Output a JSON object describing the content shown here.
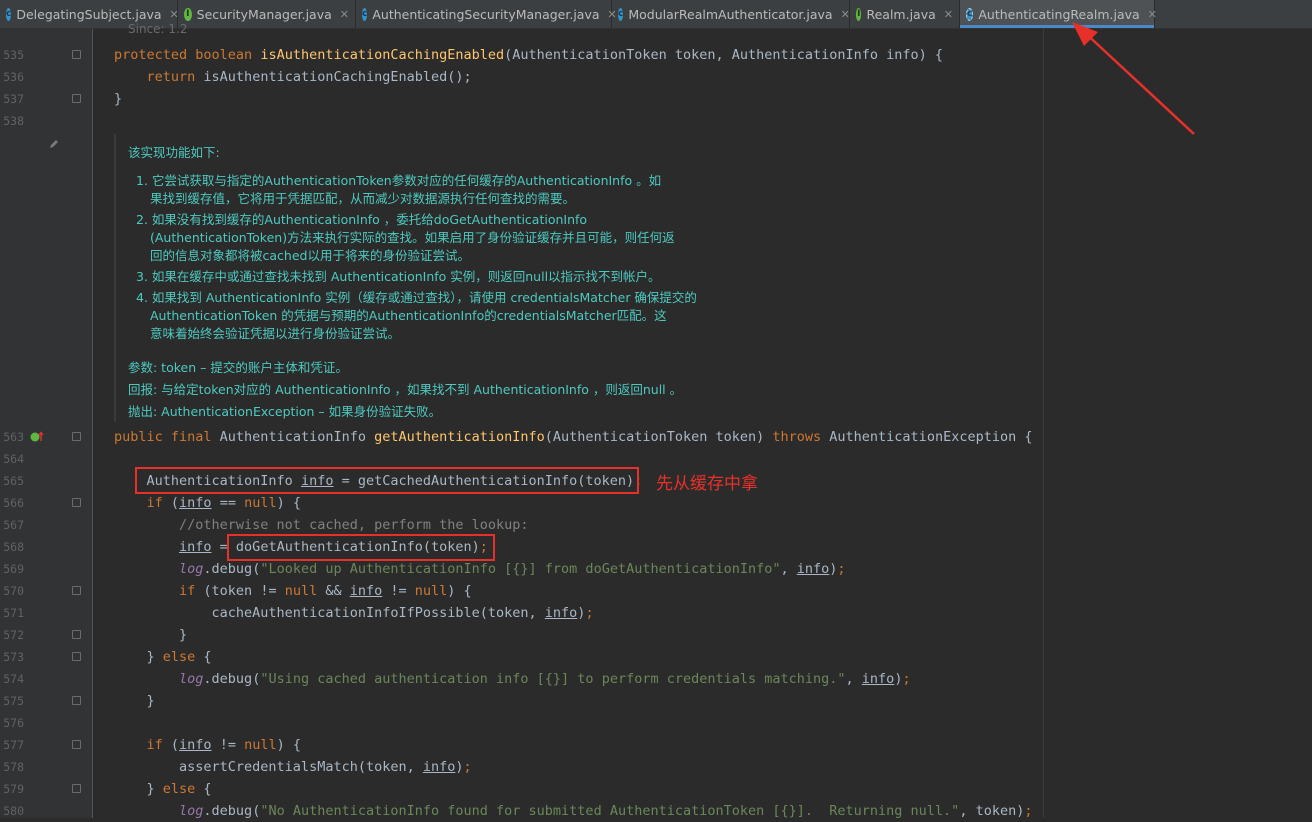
{
  "tabs": [
    {
      "label": "DelegatingSubject.java",
      "icon": "class-icon"
    },
    {
      "label": "SecurityManager.java",
      "icon": "interface-icon"
    },
    {
      "label": "AuthenticatingSecurityManager.java",
      "icon": "class-icon"
    },
    {
      "label": "ModularRealmAuthenticator.java",
      "icon": "class-icon"
    },
    {
      "label": "Realm.java",
      "icon": "interface-icon"
    },
    {
      "label": "AuthenticatingRealm.java",
      "icon": "abstract-class-icon",
      "active": true
    }
  ],
  "code_top": [
    {
      "line": "535",
      "text": "protected boolean isAuthenticationCachingEnabled(AuthenticationToken token, AuthenticationInfo info) {"
    },
    {
      "line": "536",
      "text": "    return isAuthenticationCachingEnabled();"
    },
    {
      "line": "537",
      "text": "}"
    },
    {
      "line": "538",
      "text": ""
    }
  ],
  "since_fragment": "Since:    1.2",
  "doc": {
    "intro": "该实现功能如下:",
    "items": [
      "1. 它尝试获取与指定的AuthenticationToken参数对应的任何缓存的AuthenticationInfo 。如",
      "果找到缓存值，它将用于凭据匹配，从而减少对数据源执行任何查找的需要。",
      "2. 如果没有找到缓存的AuthenticationInfo ，委托给doGetAuthenticationInfo",
      "(AuthenticationToken)方法来执行实际的查找。如果启用了身份验证缓存并且可能，则任何返",
      "回的信息对象都将被cached以用于将来的身份验证尝试。",
      "3. 如果在缓存中或通过查找未找到 AuthenticationInfo 实例，则返回null以指示找不到帐户。",
      "4. 如果找到 AuthenticationInfo 实例（缓存或通过查找），请使用 credentialsMatcher 确保提交的",
      "AuthenticationToken 的凭据与预期的AuthenticationInfo的credentialsMatcher匹配。这",
      "意味着始终会验证凭据以进行身份验证尝试。"
    ],
    "params": "参数:  token – 提交的账户主体和凭证。",
    "returns": "回报:  与给定token对应的 AuthenticationInfo ，如果找不到 AuthenticationInfo ，则返回null 。",
    "throws": "抛出:  AuthenticationException – 如果身份验证失败。"
  },
  "code_bottom": [
    {
      "line": "563",
      "text": "public final AuthenticationInfo getAuthenticationInfo(AuthenticationToken token) throws AuthenticationException {"
    },
    {
      "line": "564",
      "text": ""
    },
    {
      "line": "565",
      "text": "    AuthenticationInfo info = getCachedAuthenticationInfo(token);"
    },
    {
      "line": "566",
      "text": "    if (info == null) {"
    },
    {
      "line": "567",
      "text": "        //otherwise not cached, perform the lookup:"
    },
    {
      "line": "568",
      "text": "        info = doGetAuthenticationInfo(token);"
    },
    {
      "line": "569",
      "text": "        log.debug(\"Looked up AuthenticationInfo [{}] from doGetAuthenticationInfo\", info);"
    },
    {
      "line": "570",
      "text": "        if (token != null && info != null) {"
    },
    {
      "line": "571",
      "text": "            cacheAuthenticationInfoIfPossible(token, info);"
    },
    {
      "line": "572",
      "text": "        }"
    },
    {
      "line": "573",
      "text": "    } else {"
    },
    {
      "line": "574",
      "text": "        log.debug(\"Using cached authentication info [{}] to perform credentials matching.\", info);"
    },
    {
      "line": "575",
      "text": "    }"
    },
    {
      "line": "576",
      "text": ""
    },
    {
      "line": "577",
      "text": "    if (info != null) {"
    },
    {
      "line": "578",
      "text": "        assertCredentialsMatch(token, info);"
    },
    {
      "line": "579",
      "text": "    } else {"
    },
    {
      "line": "580",
      "text": "        log.debug(\"No AuthenticationInfo found for submitted AuthenticationToken [{}].  Returning null.\", token);"
    }
  ],
  "annotation": "先从缓存中拿",
  "colors": {
    "highlight": "#e8302a",
    "keyword": "#cc7832",
    "method": "#ffc66d",
    "string": "#6a8759",
    "doc": "#4ec9c0"
  }
}
